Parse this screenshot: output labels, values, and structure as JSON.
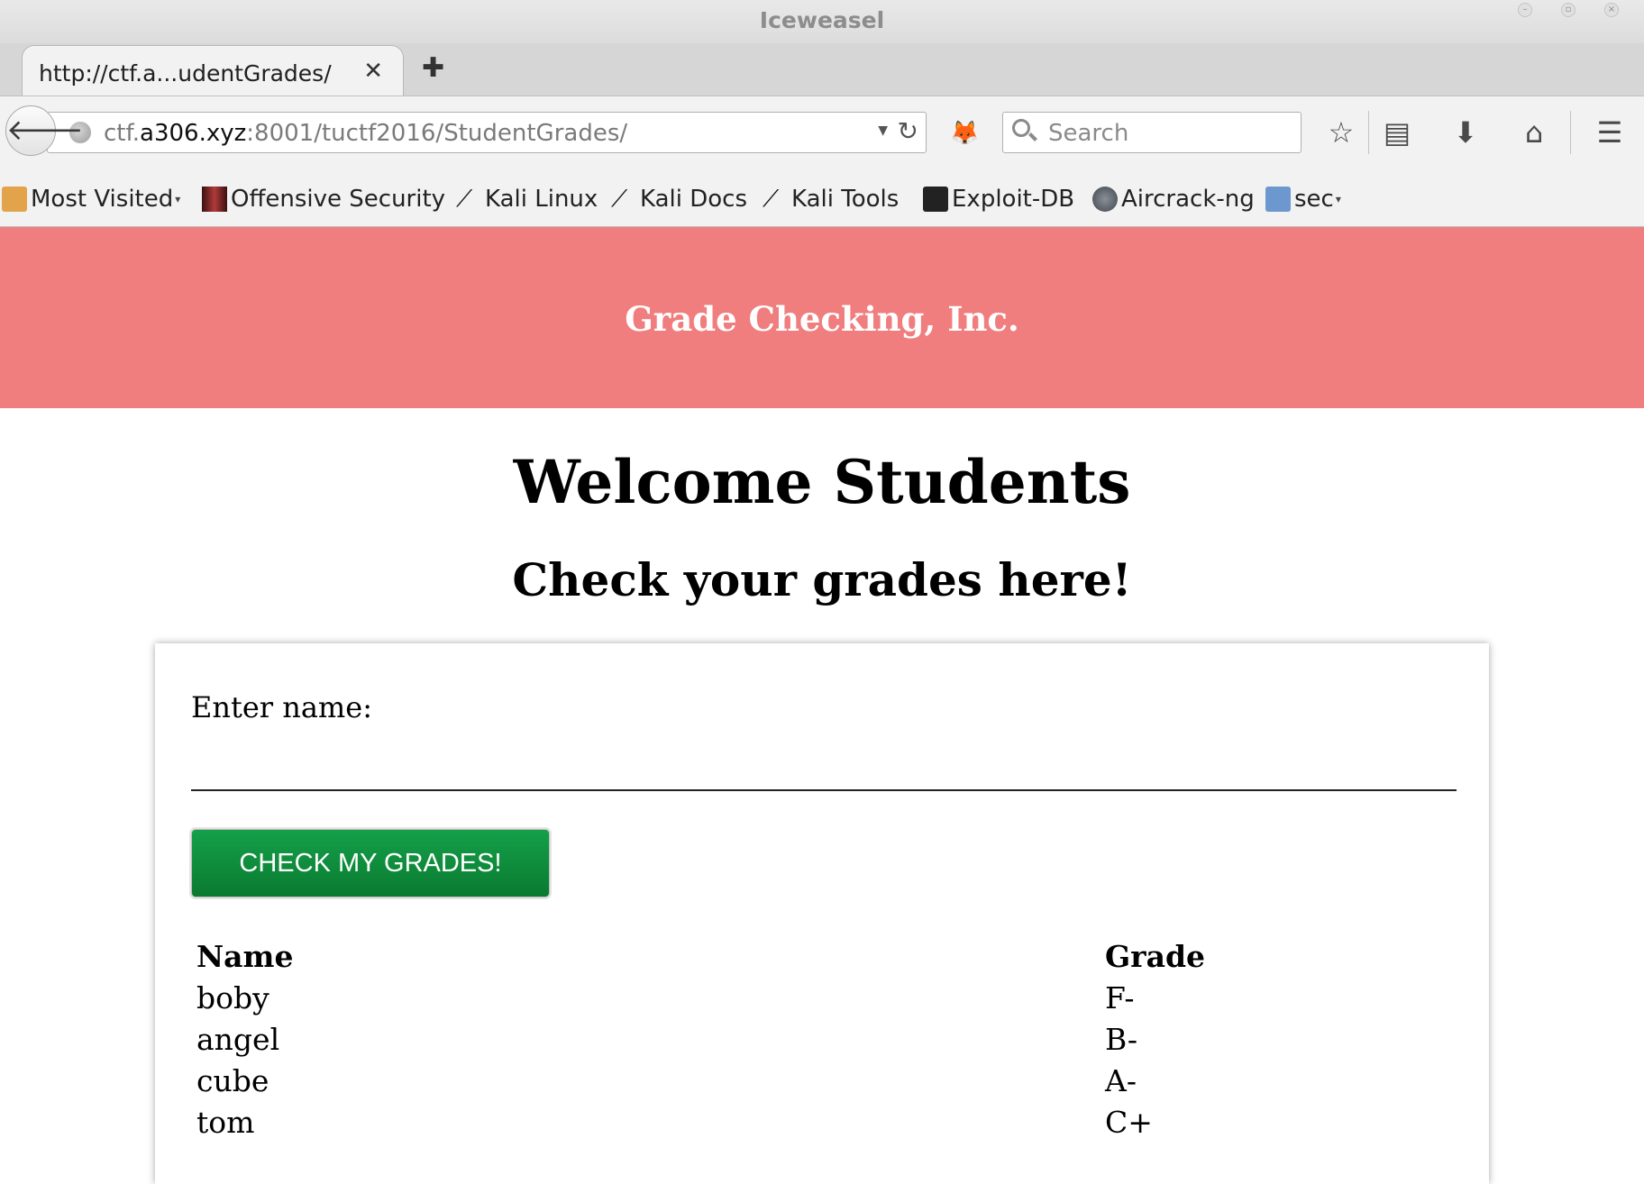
{
  "window": {
    "title": "Iceweasel"
  },
  "tab": {
    "title": "http://ctf.a...udentGrades/"
  },
  "urlbar": {
    "scheme_prefix": "ctf.",
    "host": "a306.xyz",
    "rest": ":8001/tuctf2016/StudentGrades/"
  },
  "search": {
    "placeholder": "Search"
  },
  "bookmarks": [
    {
      "label": "Most Visited",
      "icon": "folder-icon",
      "dropdown": true
    },
    {
      "label": "Offensive Security",
      "icon": "offsec-icon",
      "dropdown": false
    },
    {
      "label": "Kali Linux",
      "icon": "kali-dragon-icon",
      "dropdown": false
    },
    {
      "label": "Kali Docs",
      "icon": "kali-dragon-icon",
      "dropdown": false
    },
    {
      "label": "Kali Tools",
      "icon": "kali-dragon-icon",
      "dropdown": false
    },
    {
      "label": "Exploit-DB",
      "icon": "exploitdb-icon",
      "dropdown": false
    },
    {
      "label": "Aircrack-ng",
      "icon": "aircrack-icon",
      "dropdown": false
    },
    {
      "label": "sec",
      "icon": "folder-icon",
      "dropdown": true
    }
  ],
  "page": {
    "brand": "Grade Checking, Inc.",
    "heading": "Welcome Students",
    "subheading": "Check your grades here!",
    "form": {
      "name_label": "Enter name:",
      "name_value": "",
      "button_label": "CHECK MY GRADES!"
    },
    "table": {
      "headers": [
        "Name",
        "Grade"
      ],
      "rows": [
        [
          "boby",
          "F-"
        ],
        [
          "angel",
          "B-"
        ],
        [
          "cube",
          "A-"
        ],
        [
          "tom",
          "C+"
        ]
      ]
    }
  },
  "colors": {
    "header_bg": "#f07e7e",
    "button_green": "#0f8a3c",
    "pocket_orange": "#e07a20"
  }
}
